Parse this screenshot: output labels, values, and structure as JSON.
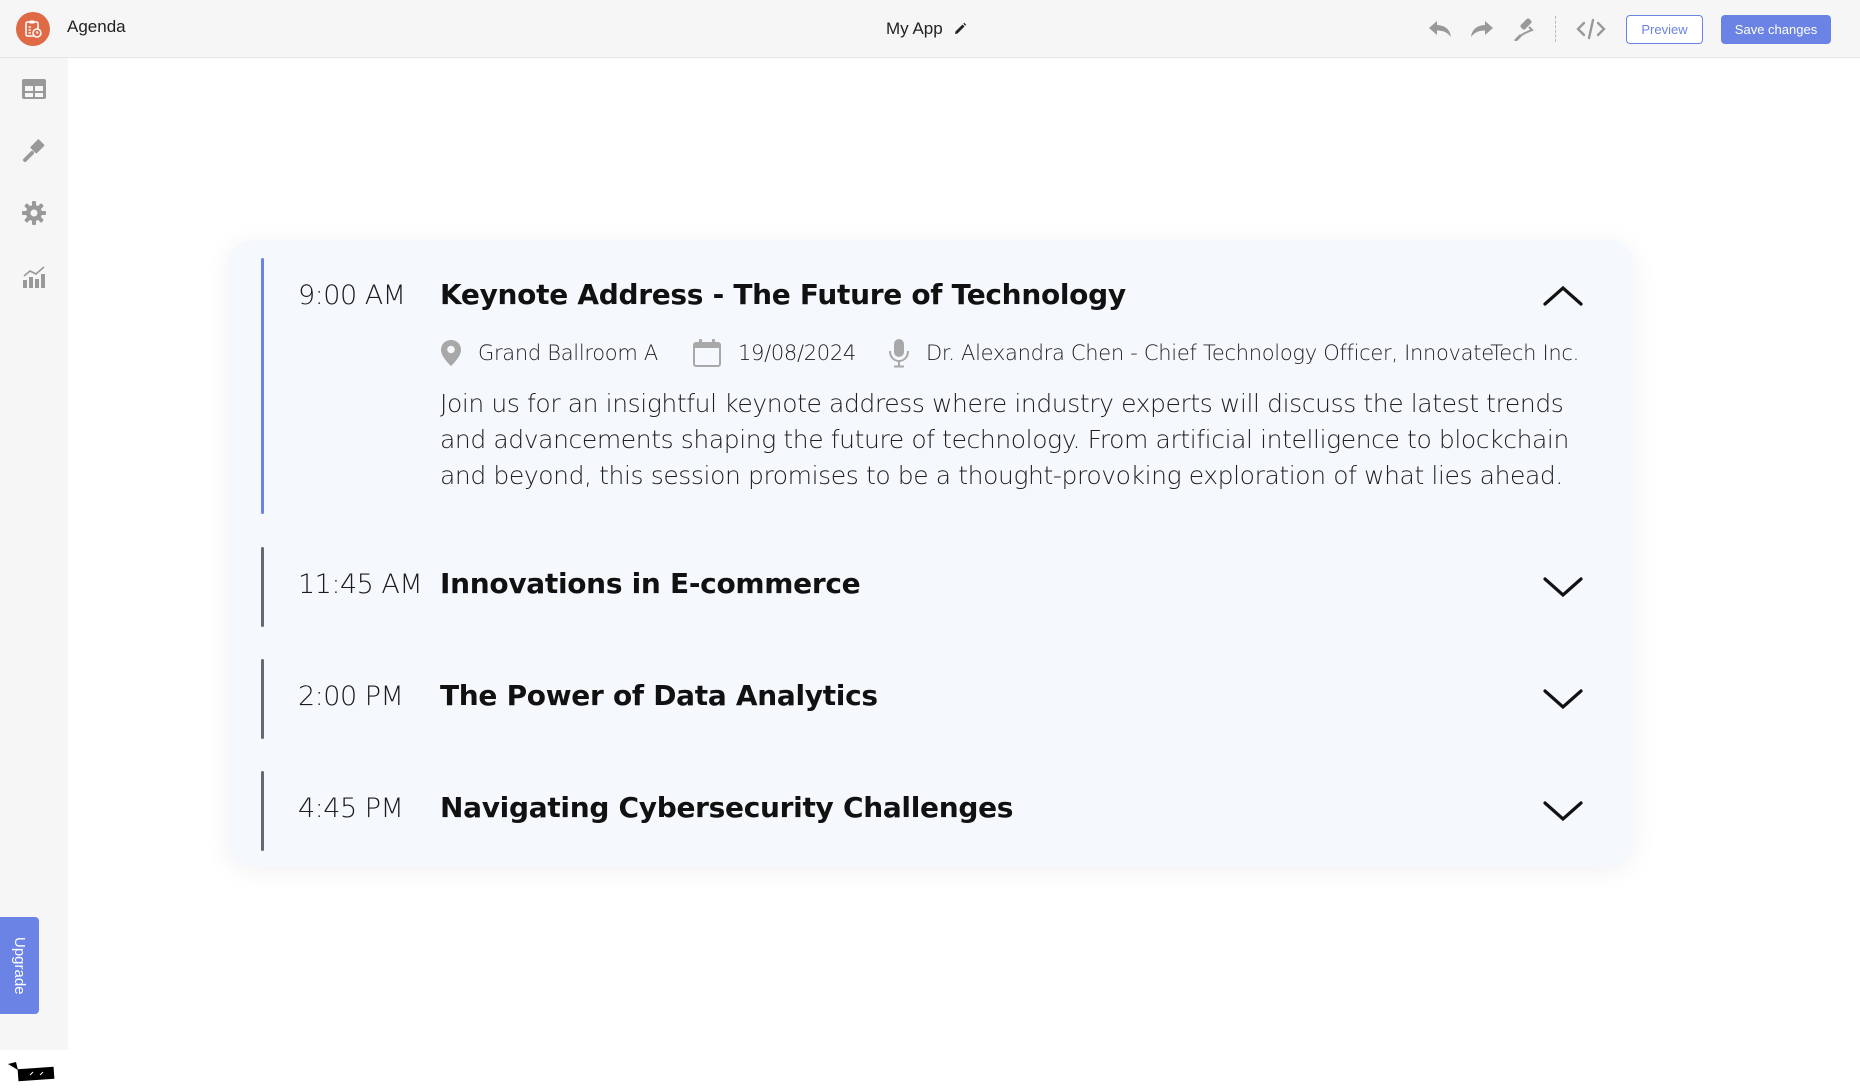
{
  "header": {
    "app_name": "Agenda",
    "project_title": "My App",
    "preview_label": "Preview",
    "save_label": "Save changes"
  },
  "sidebar": {
    "items": [
      {
        "icon": "table-icon",
        "label": "Content"
      },
      {
        "icon": "paintbrush-icon",
        "label": "Design"
      },
      {
        "icon": "gear-icon",
        "label": "Settings"
      },
      {
        "icon": "analytics-icon",
        "label": "Analytics"
      }
    ],
    "upgrade_label": "Upgrade"
  },
  "colors": {
    "accent": "#6b83e4",
    "brand": "#df6a45",
    "card_bg": "#f5f8fd",
    "inactive_bar": "#666a70"
  },
  "agenda": {
    "items": [
      {
        "time": "9:00 AM",
        "title": "Keynote Address - The Future of Technology",
        "expanded": true,
        "location": "Grand Ballroom A",
        "date": "19/08/2024",
        "speaker": "Dr. Alexandra Chen - Chief Technology Officer, InnovateTech Inc.",
        "description": "Join us for an insightful keynote address where industry experts will discuss the latest trends and advancements shaping the future of technology. From artificial intelligence to blockchain and beyond, this session promises to be a thought-provoking exploration of what lies ahead."
      },
      {
        "time": "11:45 AM",
        "title": "Innovations in E-commerce",
        "expanded": false
      },
      {
        "time": "2:00 PM",
        "title": "The Power of Data Analytics",
        "expanded": false
      },
      {
        "time": "4:45 PM",
        "title": "Navigating Cybersecurity Challenges",
        "expanded": false
      }
    ]
  }
}
